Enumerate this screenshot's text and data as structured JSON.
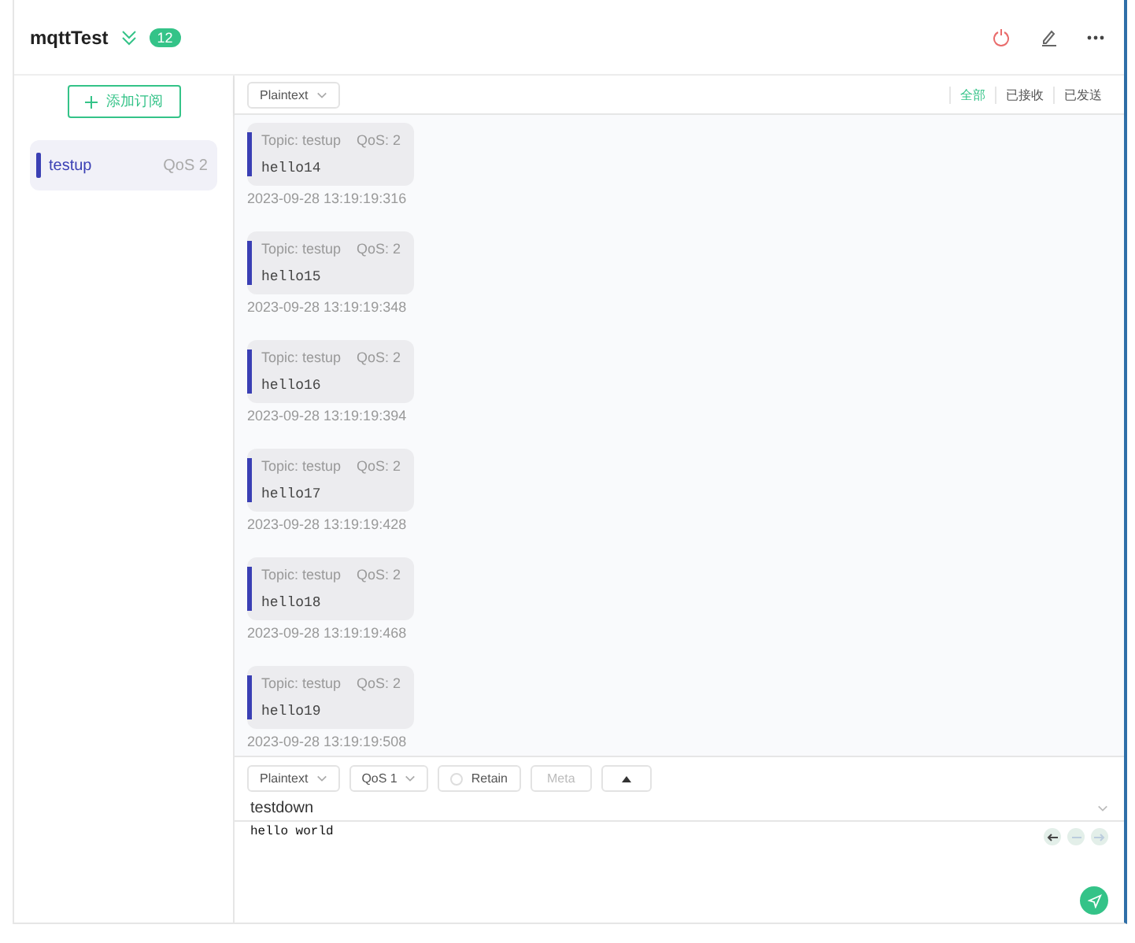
{
  "header": {
    "title": "mqttTest",
    "count": "12"
  },
  "sidebar": {
    "add_button": "添加订阅",
    "subscriptions": [
      {
        "topic": "testup",
        "qos": "QoS 2",
        "selected": true,
        "color": "#3a3fb4"
      }
    ]
  },
  "toolbar": {
    "format": "Plaintext",
    "filters": [
      {
        "label": "全部",
        "selected": true
      },
      {
        "label": "已接收",
        "selected": false
      },
      {
        "label": "已发送",
        "selected": false
      }
    ]
  },
  "messages": [
    {
      "topic": "Topic: testup",
      "qos": "QoS: 2",
      "payload": "hello14",
      "time": "2023-09-28 13:19:19:316"
    },
    {
      "topic": "Topic: testup",
      "qos": "QoS: 2",
      "payload": "hello15",
      "time": "2023-09-28 13:19:19:348"
    },
    {
      "topic": "Topic: testup",
      "qos": "QoS: 2",
      "payload": "hello16",
      "time": "2023-09-28 13:19:19:394"
    },
    {
      "topic": "Topic: testup",
      "qos": "QoS: 2",
      "payload": "hello17",
      "time": "2023-09-28 13:19:19:428"
    },
    {
      "topic": "Topic: testup",
      "qos": "QoS: 2",
      "payload": "hello18",
      "time": "2023-09-28 13:19:19:468"
    },
    {
      "topic": "Topic: testup",
      "qos": "QoS: 2",
      "payload": "hello19",
      "time": "2023-09-28 13:19:19:508"
    }
  ],
  "composer": {
    "format": "Plaintext",
    "qos": "QoS 1",
    "retain": {
      "label": "Retain",
      "checked": false
    },
    "meta": "Meta",
    "topic": "testdown",
    "payload": "hello world"
  }
}
